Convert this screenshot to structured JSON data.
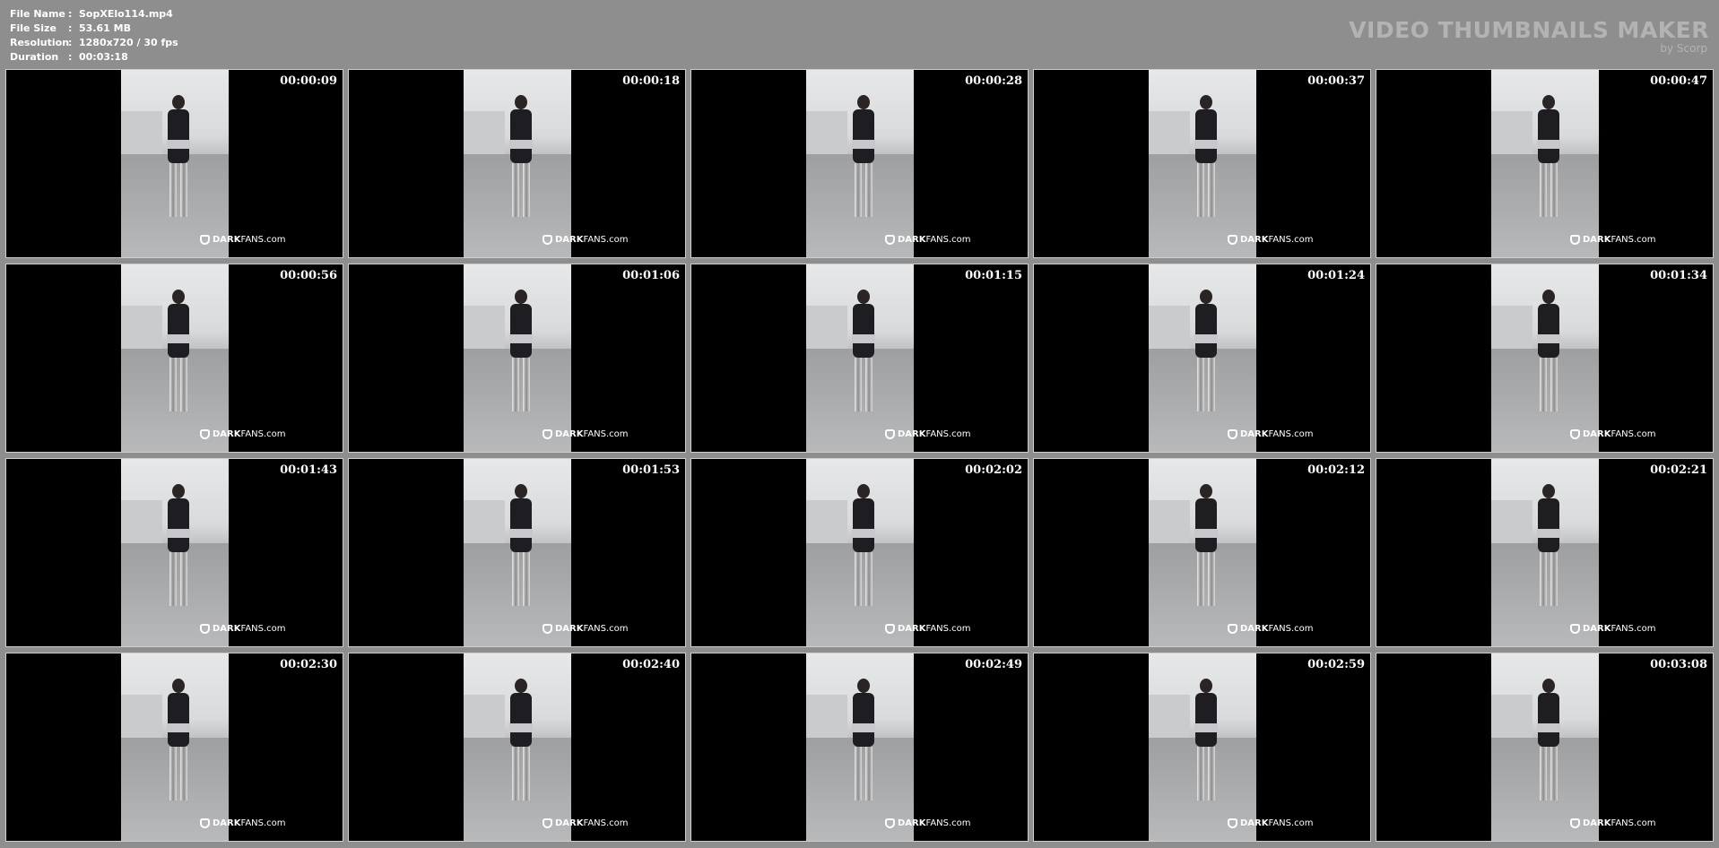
{
  "info": {
    "file_name_label": "File Name",
    "file_name": "SopXElo114.mp4",
    "file_size_label": "File Size",
    "file_size": "53.61 MB",
    "resolution_label": "Resolution",
    "resolution": "1280x720 / 30 fps",
    "duration_label": "Duration",
    "duration": "00:03:18",
    "separator": ":"
  },
  "brand": {
    "title": "VIDEO THUMBNAILS MAKER",
    "subtitle": "by Scorp"
  },
  "watermark": {
    "bold": "DARK",
    "regular": "FANS.com"
  },
  "thumbnails": [
    {
      "time": "00:00:09"
    },
    {
      "time": "00:00:18"
    },
    {
      "time": "00:00:28"
    },
    {
      "time": "00:00:37"
    },
    {
      "time": "00:00:47"
    },
    {
      "time": "00:00:56"
    },
    {
      "time": "00:01:06"
    },
    {
      "time": "00:01:15"
    },
    {
      "time": "00:01:24"
    },
    {
      "time": "00:01:34"
    },
    {
      "time": "00:01:43"
    },
    {
      "time": "00:01:53"
    },
    {
      "time": "00:02:02"
    },
    {
      "time": "00:02:12"
    },
    {
      "time": "00:02:21"
    },
    {
      "time": "00:02:30"
    },
    {
      "time": "00:02:40"
    },
    {
      "time": "00:02:49"
    },
    {
      "time": "00:02:59"
    },
    {
      "time": "00:03:08"
    }
  ]
}
